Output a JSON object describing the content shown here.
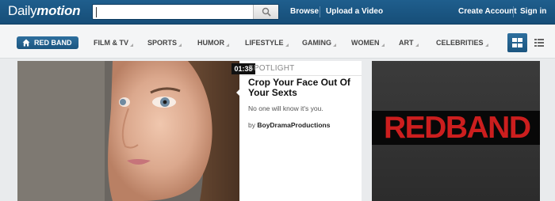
{
  "header": {
    "logo_part1": "Daily",
    "logo_part2": "motion",
    "search_placeholder": "",
    "links": {
      "browse": "Browse",
      "upload": "Upload a Video",
      "create_account": "Create Account",
      "sign_in": "Sign in"
    }
  },
  "categories": {
    "active": "RED BAND",
    "items": [
      "FILM & TV",
      "SPORTS",
      "HUMOR",
      "LIFESTYLE",
      "GAMING",
      "WOMEN",
      "ART",
      "CELEBRITIES"
    ]
  },
  "feature": {
    "duration": "01:38",
    "section": "SPOTLIGHT",
    "title": "Crop Your Face Out Of Your Sexts",
    "description": "No one will know it's you.",
    "by_prefix": "by",
    "author": "BoyDramaProductions"
  },
  "promo": {
    "text": "REDBAND"
  },
  "colors": {
    "header_blue": "#1f5e8d",
    "accent_red": "#cc1e1e"
  },
  "icons": [
    "search-icon",
    "home-icon",
    "grid-view-icon",
    "list-view-icon"
  ]
}
